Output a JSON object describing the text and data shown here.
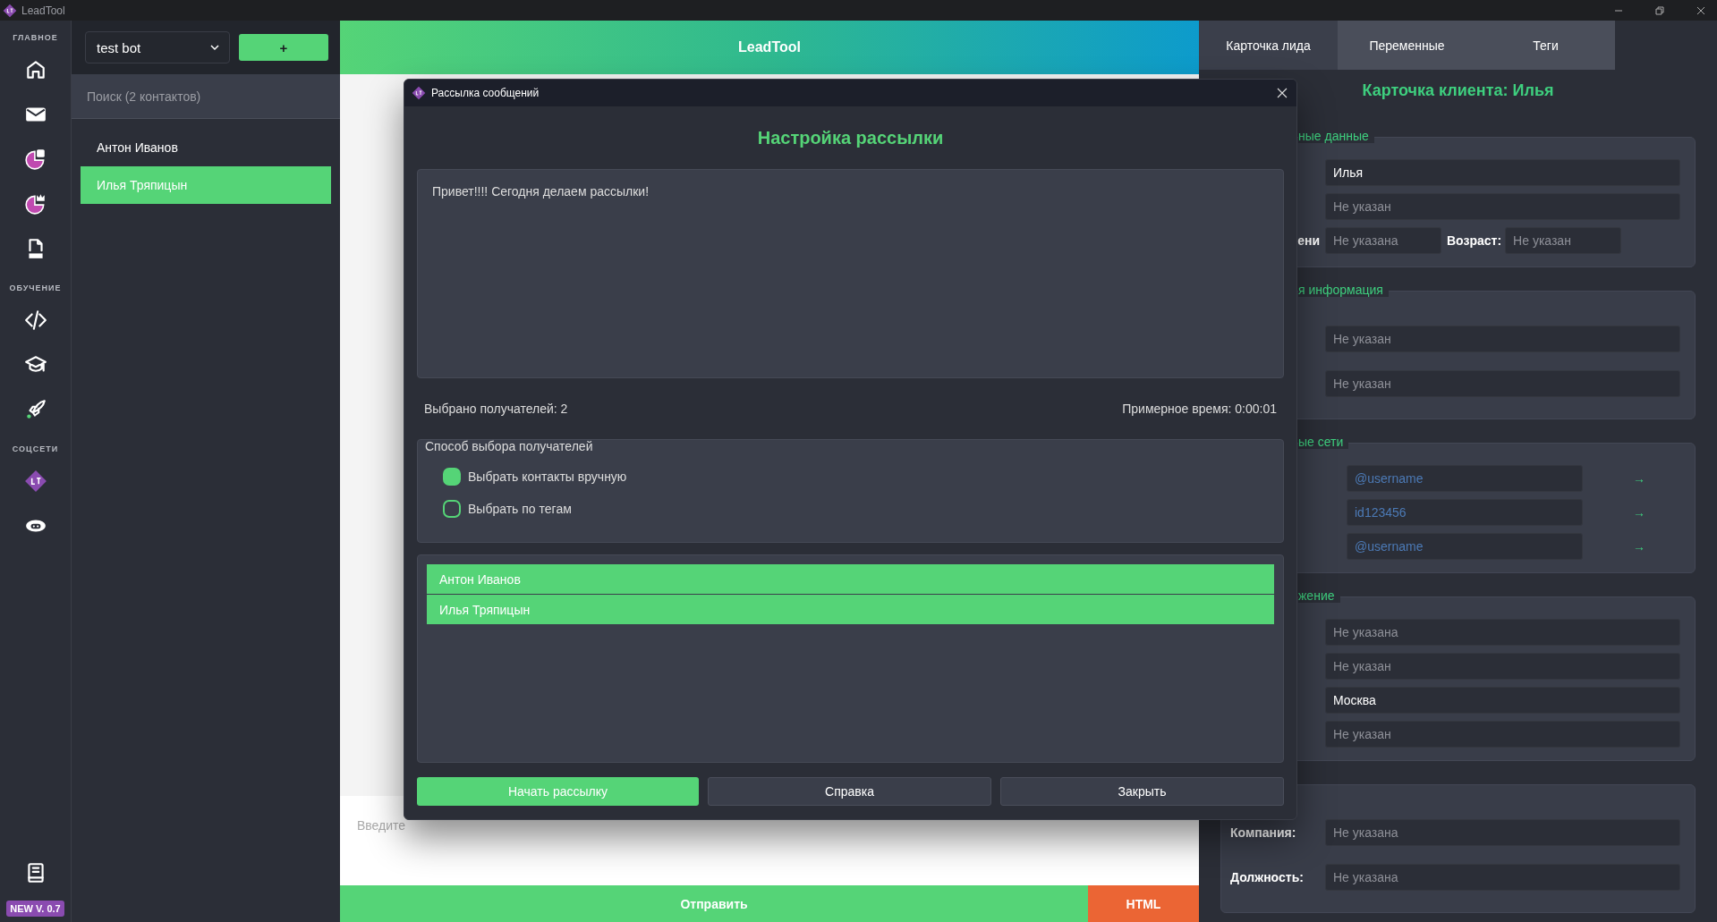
{
  "app_title": "LeadTool",
  "sidebar": {
    "sections": [
      {
        "label": "ГЛАВНОЕ"
      },
      {
        "label": "ОБУЧЕНИЕ"
      },
      {
        "label": "СОЦСЕТИ"
      }
    ],
    "version_badge": "NEW V. 0.7"
  },
  "contacts": {
    "bot_select": "test bot",
    "add_button": "+",
    "search_placeholder": "Поиск (2 контактов)",
    "items": [
      {
        "name": "Антон Иванов",
        "selected": false
      },
      {
        "name": "Илья Тряпицын",
        "selected": true
      }
    ]
  },
  "chat": {
    "header": "LeadTool",
    "input_placeholder": "Введите",
    "send_button": "Отправить",
    "html_button": "HTML"
  },
  "dialog": {
    "title": "Рассылка сообщений",
    "heading": "Настройка рассылки",
    "message": "Привет!!!! Сегодня делаем рассылки!",
    "recipients_count": "Выбрано получателей: 2",
    "estimated_time": "Примерное время: 0:00:01",
    "method_group": {
      "title": "Способ выбора получателей",
      "options": [
        {
          "label": "Выбрать контакты вручную",
          "selected": true
        },
        {
          "label": "Выбрать по тегам",
          "selected": false
        }
      ]
    },
    "recipients": [
      {
        "name": "Антон Иванов",
        "selected": true
      },
      {
        "name": "Илья Тряпицын",
        "selected": true
      }
    ],
    "buttons": [
      {
        "label": "Начать рассылку",
        "kind": "primary"
      },
      {
        "label": "Справка",
        "kind": "secondary"
      },
      {
        "label": "Закрыть",
        "kind": "secondary"
      }
    ]
  },
  "lead_panel": {
    "tabs": [
      {
        "label": "Карточка лида",
        "selected": true
      },
      {
        "label": "Переменные",
        "selected": false
      },
      {
        "label": "Теги",
        "selected": false
      }
    ],
    "title": "Карточка клиента: Илья",
    "groups": [
      {
        "title": "ные данные",
        "rows": [
          {
            "fields": [
              {
                "value": "Илья"
              }
            ]
          },
          {
            "fields": [
              {
                "placeholder": "Не указан"
              }
            ]
          },
          {
            "fields": [
              {
                "label": "ени",
                "placeholder": "Не указана"
              },
              {
                "label": "Возраст:",
                "placeholder": "Не указан"
              }
            ]
          }
        ]
      },
      {
        "title": "я информация",
        "rows": [
          {
            "fields": [
              {
                "placeholder": "Не указан"
              }
            ]
          },
          {
            "fields": [
              {
                "placeholder": "Не указан"
              }
            ]
          }
        ]
      },
      {
        "title": "ые сети",
        "rows": [
          {
            "kind": "social",
            "fields": [
              {
                "placeholder": "@username"
              }
            ],
            "arrow": "→"
          },
          {
            "kind": "social",
            "fields": [
              {
                "placeholder": "id123456"
              }
            ],
            "arrow": "→"
          },
          {
            "kind": "social",
            "fields": [
              {
                "placeholder": "@username"
              }
            ],
            "arrow": "→"
          }
        ]
      },
      {
        "title": "жение",
        "rows": [
          {
            "fields": [
              {
                "placeholder": "Не указана"
              }
            ]
          },
          {
            "fields": [
              {
                "placeholder": "Не указан"
              }
            ]
          },
          {
            "fields": [
              {
                "value": "Москва"
              }
            ]
          },
          {
            "fields": [
              {
                "placeholder": "Не указан"
              }
            ]
          }
        ]
      },
      {
        "rows": [
          {
            "fields": [
              {
                "label": "Компания:",
                "placeholder": "Не указана"
              }
            ]
          },
          {
            "fields": [
              {
                "label": "Должность:",
                "placeholder": "Не указана"
              }
            ]
          }
        ]
      }
    ]
  }
}
